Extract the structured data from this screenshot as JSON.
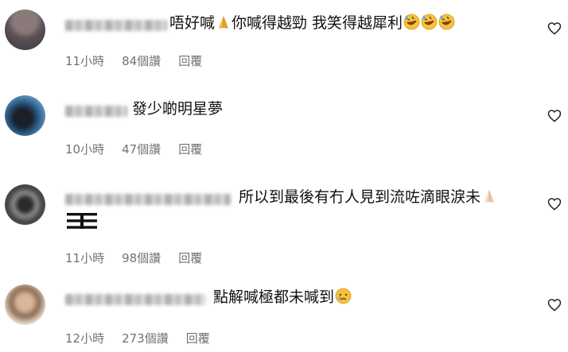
{
  "comments": [
    {
      "text_a": "唔好喊",
      "text_b": "你喊得越勁 我笑得越犀利",
      "time": "11小時",
      "likes": "84個讚",
      "reply": "回覆"
    },
    {
      "text": "發少啲明星夢",
      "time": "10小時",
      "likes": "47個讚",
      "reply": "回覆"
    },
    {
      "text": "所以到最後有冇人見到流咗滴眼淚未",
      "time": "11小時",
      "likes": "98個讚",
      "reply": "回覆"
    },
    {
      "text": "點解喊極都未喊到",
      "time": "12小時",
      "likes": "273個讚",
      "reply": "回覆"
    }
  ],
  "icons": {
    "like": "heart-outline-icon",
    "pray": "folded-hands-emoji",
    "laugh": "rolling-on-floor-laughing-emoji",
    "cry": "crying-face-emoji",
    "trigram": "trigram-glyph"
  },
  "colors": {
    "text": "#111111",
    "meta": "#737373",
    "heart": "#262626",
    "emoji_yellow": "#f7c23b"
  }
}
